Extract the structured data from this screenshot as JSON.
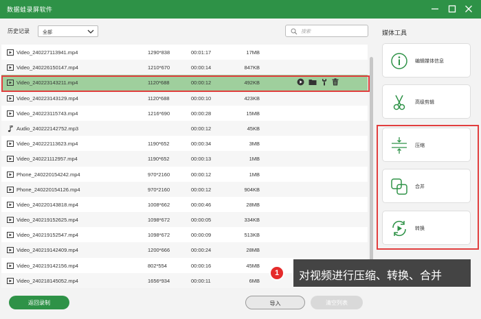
{
  "window": {
    "title": "数据蛙录屏软件"
  },
  "filter": {
    "history_label": "历史记录",
    "select_value": "全部",
    "search_placeholder": "搜索"
  },
  "files": [
    {
      "name": "Video_240227113941.mp4",
      "type": "video",
      "resolution": "1290*838",
      "duration": "00:01:17",
      "size": "17MB"
    },
    {
      "name": "Video_240226150147.mp4",
      "type": "video",
      "resolution": "1210*670",
      "duration": "00:00:14",
      "size": "847KB"
    },
    {
      "name": "Video_240223143211.mp4",
      "type": "video",
      "resolution": "1120*688",
      "duration": "00:00:12",
      "size": "492KB",
      "selected": true
    },
    {
      "name": "Video_240223143129.mp4",
      "type": "video",
      "resolution": "1120*688",
      "duration": "00:00:10",
      "size": "423KB"
    },
    {
      "name": "Video_240223115743.mp4",
      "type": "video",
      "resolution": "1216*690",
      "duration": "00:00:28",
      "size": "15MB"
    },
    {
      "name": "Audio_240222142752.mp3",
      "type": "audio",
      "resolution": "",
      "duration": "00:00:12",
      "size": "45KB"
    },
    {
      "name": "Video_240222113623.mp4",
      "type": "video",
      "resolution": "1190*652",
      "duration": "00:00:34",
      "size": "3MB"
    },
    {
      "name": "Video_240221112957.mp4",
      "type": "video",
      "resolution": "1190*652",
      "duration": "00:00:13",
      "size": "1MB"
    },
    {
      "name": "Phone_240220154242.mp4",
      "type": "video",
      "resolution": "970*2160",
      "duration": "00:00:12",
      "size": "1MB"
    },
    {
      "name": "Phone_240220154126.mp4",
      "type": "video",
      "resolution": "970*2160",
      "duration": "00:00:12",
      "size": "904KB"
    },
    {
      "name": "Video_240220143818.mp4",
      "type": "video",
      "resolution": "1008*662",
      "duration": "00:00:46",
      "size": "28MB"
    },
    {
      "name": "Video_240219152625.mp4",
      "type": "video",
      "resolution": "1098*672",
      "duration": "00:00:05",
      "size": "334KB"
    },
    {
      "name": "Video_240219152547.mp4",
      "type": "video",
      "resolution": "1098*672",
      "duration": "00:00:09",
      "size": "513KB"
    },
    {
      "name": "Video_240219142409.mp4",
      "type": "video",
      "resolution": "1200*666",
      "duration": "00:00:24",
      "size": "28MB"
    },
    {
      "name": "Video_240219142156.mp4",
      "type": "video",
      "resolution": "802*554",
      "duration": "00:00:16",
      "size": "45MB"
    },
    {
      "name": "Video_240218145052.mp4",
      "type": "video",
      "resolution": "1656*934",
      "duration": "00:00:11",
      "size": "6MB"
    }
  ],
  "row_actions": [
    "play-icon",
    "folder-icon",
    "tools-icon",
    "delete-icon"
  ],
  "sidebar": {
    "title": "媒体工具",
    "tools": [
      {
        "label": "编辑媒体信息",
        "icon": "info-icon"
      },
      {
        "label": "高级剪辑",
        "icon": "scissors-icon"
      },
      {
        "label": "压缩",
        "icon": "compress-icon"
      },
      {
        "label": "合并",
        "icon": "merge-icon"
      },
      {
        "label": "转换",
        "icon": "convert-icon"
      }
    ]
  },
  "buttons": {
    "back": "返回录制",
    "import": "导入",
    "clear": "清空列表"
  },
  "tip": {
    "number": "1",
    "text": "对视频进行压缩、转换、合并"
  },
  "colors": {
    "brand": "#2e9247",
    "highlight": "#e13d3d",
    "selected_row": "#9fcf9d"
  }
}
